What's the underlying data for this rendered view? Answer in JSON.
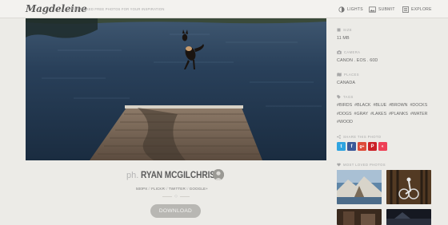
{
  "header": {
    "logo": "Magdeleine",
    "tagline": "HAND-PICKED FREE PHOTOS FOR YOUR INSPIRATION",
    "nav": [
      {
        "label": "LIGHTS",
        "icon": "contrast-icon"
      },
      {
        "label": "SUBMIT",
        "icon": "image-icon"
      },
      {
        "label": "EXPLORE",
        "icon": "menu-icon"
      }
    ]
  },
  "photo": {
    "alt": "Dog jumping off a wooden dock into a lake"
  },
  "photographer": {
    "prefix": "ph.",
    "name": "RYAN MCGILCHRIST",
    "links": [
      "500PX",
      "FLICKR",
      "TWITTER",
      "GOOGLE+"
    ],
    "separator": "//"
  },
  "download_label": "DOWNLOAD",
  "sidebar": {
    "size": {
      "label": "SIZE",
      "value": "11 MB"
    },
    "camera": {
      "label": "CAMERA",
      "value": "CANON . EOS . 60D"
    },
    "places": {
      "label": "PLACES",
      "value": "CANADA"
    },
    "tags": {
      "label": "TAGS",
      "items": [
        "#BIRDS",
        "#BLACK",
        "#BLUE",
        "#BROWN",
        "#DOCKS",
        "#DOGS",
        "#GRAY",
        "#LAKES",
        "#PLANKS",
        "#WATER",
        "#WOOD"
      ]
    },
    "share": {
      "label": "SHARE THIS PHOTO",
      "buttons": [
        {
          "glyph": "t",
          "icon": "twitter-icon",
          "color": "#2fa4e0"
        },
        {
          "glyph": "f",
          "icon": "facebook-icon",
          "color": "#3b5998"
        },
        {
          "glyph": "g+",
          "icon": "google-plus-icon",
          "color": "#dd4b39"
        },
        {
          "glyph": "P",
          "icon": "pinterest-icon",
          "color": "#cb2027"
        },
        {
          "glyph": "◐",
          "icon": "pocket-icon",
          "color": "#ee4056"
        }
      ]
    },
    "most_loved": {
      "label": "MOST LOVED PHOTOS"
    }
  }
}
